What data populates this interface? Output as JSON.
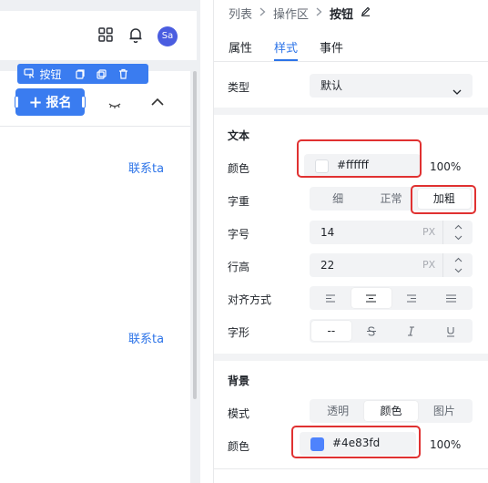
{
  "canvas": {
    "avatar": "Sa",
    "toolbar_label": "按钮",
    "button_label": "报名",
    "button_plus": "+",
    "contact_links": [
      "联系ta",
      "联系ta"
    ]
  },
  "panel": {
    "breadcrumb": [
      "列表",
      "操作区",
      "按钮"
    ],
    "tabs": [
      "属性",
      "样式",
      "事件"
    ],
    "active_tab": "样式",
    "type": {
      "label": "类型",
      "value": "默认"
    },
    "text_section": "文本",
    "text_color": {
      "label": "颜色",
      "hex": "#ffffff",
      "opacity": "100%"
    },
    "weight": {
      "label": "字重",
      "options": [
        "细",
        "正常",
        "加粗"
      ],
      "selected": "加粗"
    },
    "size": {
      "label": "字号",
      "value": "14",
      "unit": "PX"
    },
    "line_height": {
      "label": "行高",
      "value": "22",
      "unit": "PX"
    },
    "align": {
      "label": "对齐方式"
    },
    "style": {
      "label": "字形",
      "none_symbol": "--"
    },
    "bg_section": "背景",
    "bg_mode": {
      "label": "模式",
      "options": [
        "透明",
        "颜色",
        "图片"
      ],
      "selected": "颜色"
    },
    "bg_color": {
      "label": "颜色",
      "hex": "#4e83fd",
      "opacity": "100%"
    }
  },
  "colors": {
    "accent": "#2d74e8",
    "highlight": "#e03131",
    "text_swatch": "#ffffff",
    "bg_swatch": "#4e83fd"
  }
}
